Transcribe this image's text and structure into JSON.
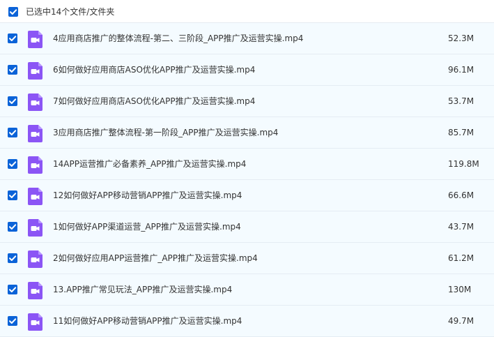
{
  "colors": {
    "checkbox": "#0b63d8",
    "video_icon": "#8b55f5",
    "row_background": "#f4fbff",
    "text": "#333333"
  },
  "header": {
    "selection_label": "已选中14个文件/文件夹",
    "checkbox_icon": "checkmark-icon"
  },
  "files": [
    {
      "name": "4应用商店推广的整体流程-第二、三阶段_APP推广及运营实操.mp4",
      "size": "52.3M",
      "icon": "video-file-icon"
    },
    {
      "name": "6如何做好应用商店ASO优化APP推广及运营实操.mp4",
      "size": "96.1M",
      "icon": "video-file-icon"
    },
    {
      "name": "7如何做好应用商店ASO优化APP推广及运营实操.mp4",
      "size": "53.7M",
      "icon": "video-file-icon"
    },
    {
      "name": "3应用商店推广整体流程-第一阶段_APP推广及运营实操.mp4",
      "size": "85.7M",
      "icon": "video-file-icon"
    },
    {
      "name": "14APP运营推广必备素养_APP推广及运营实操.mp4",
      "size": "119.8M",
      "icon": "video-file-icon"
    },
    {
      "name": "12如何做好APP移动营销APP推广及运营实操.mp4",
      "size": "66.6M",
      "icon": "video-file-icon"
    },
    {
      "name": "1如何做好APP渠道运营_APP推广及运营实操.mp4",
      "size": "43.7M",
      "icon": "video-file-icon"
    },
    {
      "name": "2如何做好应用APP运营推广_APP推广及运营实操.mp4",
      "size": "61.2M",
      "icon": "video-file-icon"
    },
    {
      "name": "13.APP推广常见玩法_APP推广及运营实操.mp4",
      "size": "130M",
      "icon": "video-file-icon"
    },
    {
      "name": "11如何做好APP移动营销APP推广及运营实操.mp4",
      "size": "49.7M",
      "icon": "video-file-icon"
    }
  ]
}
